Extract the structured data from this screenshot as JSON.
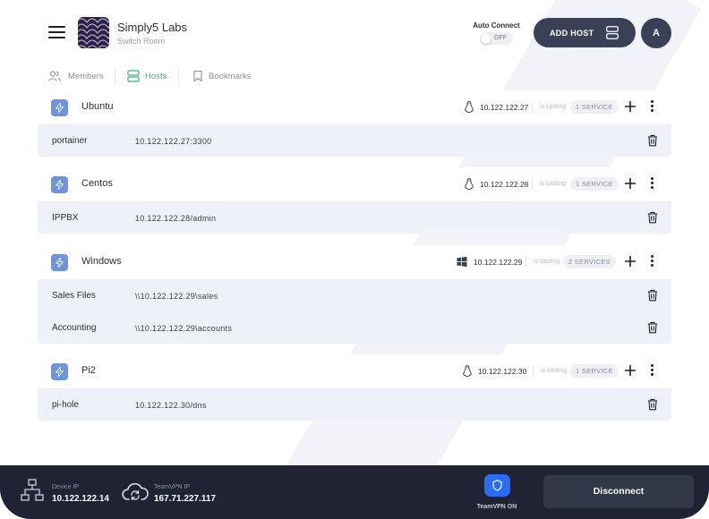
{
  "header": {
    "brand_title": "Simply5 Labs",
    "brand_subtitle": "Switch Room",
    "auto_connect_label": "Auto Connect",
    "auto_connect_state": "OFF",
    "add_host_label": "ADD HOST",
    "avatar_initial": "A"
  },
  "tabs": [
    {
      "label": "Members",
      "icon": "users-icon",
      "active": false
    },
    {
      "label": "Hosts",
      "icon": "server-icon",
      "active": true
    },
    {
      "label": "Bookmarks",
      "icon": "bookmark-icon",
      "active": false
    }
  ],
  "hosts": [
    {
      "name": "Ubuntu",
      "os": "linux",
      "ip": "10.122.122.27",
      "casting": "is casting",
      "services_badge": "1 SERVICE",
      "services": [
        {
          "name": "portainer",
          "address": "10.122.122.27:3300"
        }
      ]
    },
    {
      "name": "Centos",
      "os": "linux",
      "ip": "10.122.122.28",
      "casting": "is casting",
      "services_badge": "1 SERVICE",
      "services": [
        {
          "name": "IPPBX",
          "address": "10.122.122.28/admin"
        }
      ]
    },
    {
      "name": "Windows",
      "os": "windows",
      "ip": "10.122.122.29",
      "casting": "is casting",
      "services_badge": "2 SERVICES",
      "services": [
        {
          "name": "Sales Files",
          "address": "\\\\10.122.122.29\\sales"
        },
        {
          "name": "Accounting",
          "address": "\\\\10.122.122.29\\accounts"
        }
      ]
    },
    {
      "name": "Pi2",
      "os": "linux",
      "ip": "10.122.122.30",
      "casting": "is casting",
      "services_badge": "1 SERVICE",
      "services": [
        {
          "name": "pi-hole",
          "address": "10.122.122.30/dns"
        }
      ]
    }
  ],
  "footer": {
    "device_ip_label": "Device IP",
    "device_ip": "10.122.122.14",
    "vpn_ip_label": "TeamVPN IP",
    "vpn_ip": "167.71.227.117",
    "vpn_state": "TeamVPN ON",
    "disconnect_label": "Disconnect"
  },
  "colors": {
    "accent_green": "#3bb273",
    "bolt_blue": "#6e93df",
    "dark": "#3a4157",
    "footer": "#1f2333",
    "shield_blue": "#2a6df4"
  }
}
